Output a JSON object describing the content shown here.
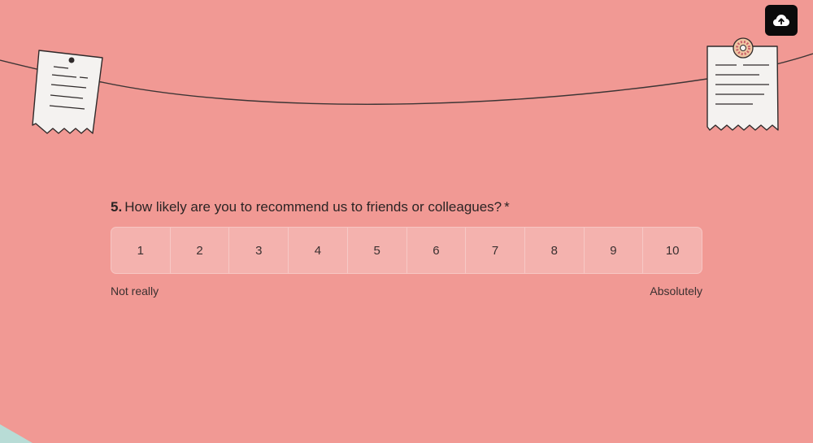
{
  "header": {
    "upload_icon": "cloud-upload-icon"
  },
  "question": {
    "number": "5.",
    "text": "How likely are you to recommend us to friends or colleagues?",
    "required_mark": "*"
  },
  "scale": {
    "options": [
      "1",
      "2",
      "3",
      "4",
      "5",
      "6",
      "7",
      "8",
      "9",
      "10"
    ],
    "low_label": "Not really",
    "high_label": "Absolutely"
  },
  "colors": {
    "background": "#f19994",
    "scale_fill": "#f4b2ae",
    "button": "#0b0b0b",
    "accent_corner": "#b8dcd6"
  }
}
